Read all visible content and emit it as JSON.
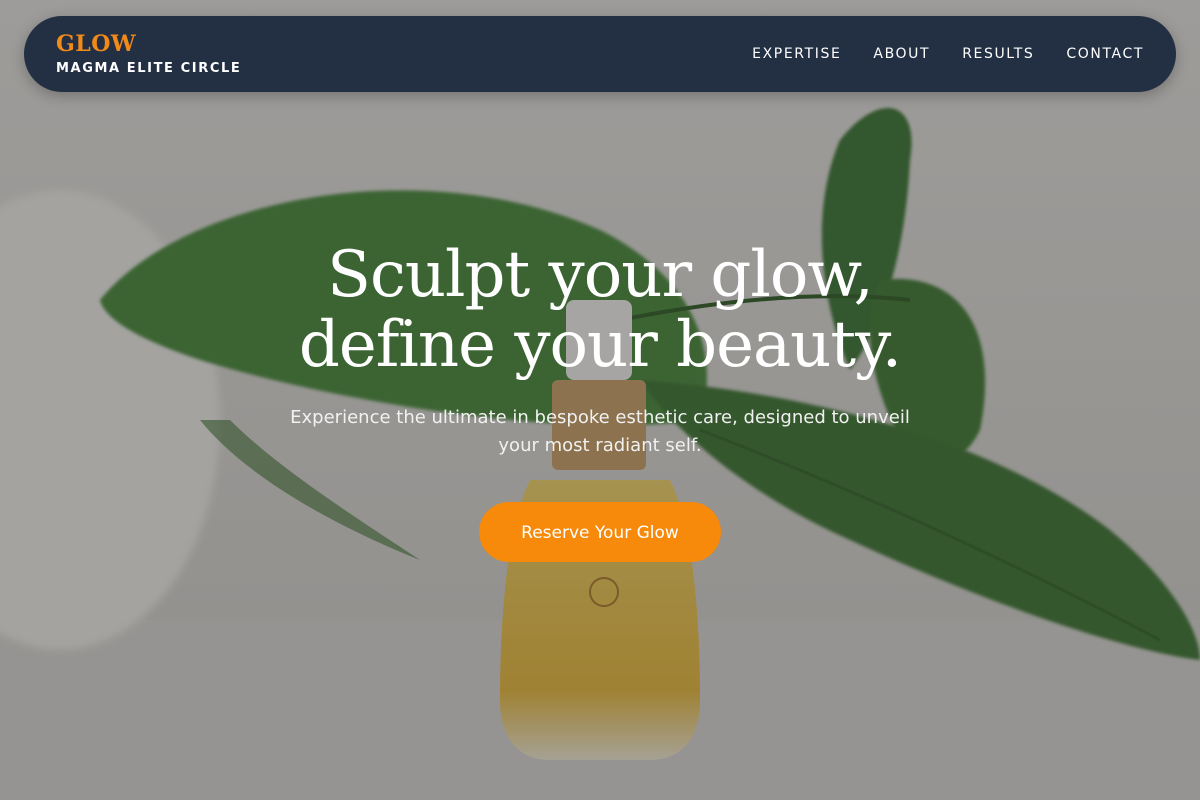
{
  "brand": {
    "title": "GLOW",
    "subtitle": "MAGMA ELITE CIRCLE"
  },
  "nav": {
    "items": [
      {
        "label": "EXPERTISE"
      },
      {
        "label": "ABOUT"
      },
      {
        "label": "RESULTS"
      },
      {
        "label": "CONTACT"
      }
    ]
  },
  "hero": {
    "headline_line1": "Sculpt your glow,",
    "headline_line2": "define your beauty.",
    "subtext": "Experience the ultimate in bespoke esthetic care, designed to unveil your most radiant self.",
    "cta_label": "Reserve Your Glow",
    "background_image": "serum bottle with green leaves"
  },
  "colors": {
    "nav_background": "#232f43",
    "accent": "#f7890b",
    "brand_title": "#f28a1a"
  }
}
